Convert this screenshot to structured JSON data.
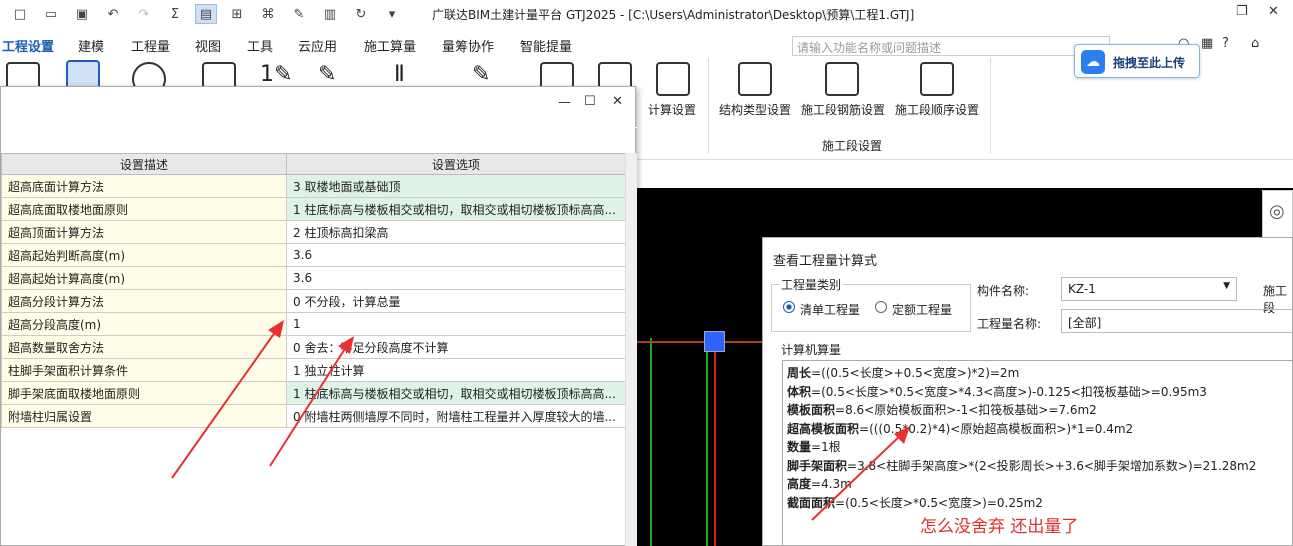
{
  "app": {
    "title": "广联达BIM土建计量平台 GTJ2025 - [C:\\Users\\Administrator\\Desktop\\预算\\工程1.GTJ]"
  },
  "menu": {
    "tabs": [
      "工程设置",
      "建模",
      "工程量",
      "视图",
      "工具",
      "云应用",
      "施工算量",
      "量筹协作",
      "智能提量"
    ],
    "search_placeholder": "请输入功能名称或问题描述"
  },
  "upload": {
    "label": "拖拽至此上传"
  },
  "ribbon": {
    "calc_settings": "计算设置",
    "structure_type": "结构类型设置",
    "section_rebar": "施工段钢筋设置",
    "section_order": "施工段顺序设置",
    "group_section": "施工段设置"
  },
  "settings": {
    "headers": [
      "设置描述",
      "设置选项"
    ],
    "rows": [
      {
        "desc": "超高底面计算方法",
        "value": "3 取楼地面或基础顶"
      },
      {
        "desc": "超高底面取楼地面原则",
        "value": "1 柱底标高与楼板相交或相切，取相交或相切楼板顶标高高..."
      },
      {
        "desc": "超高顶面计算方法",
        "value": "2 柱顶标高扣梁高"
      },
      {
        "desc": "超高起始判断高度(m)",
        "value": "3.6"
      },
      {
        "desc": "超高起始计算高度(m)",
        "value": "3.6"
      },
      {
        "desc": "超高分段计算方法",
        "value": "0 不分段，计算总量"
      },
      {
        "desc": "超高分段高度(m)",
        "value": "1"
      },
      {
        "desc": "超高数量取舍方法",
        "value": "0 舍去：不足分段高度不计算"
      },
      {
        "desc": "柱脚手架面积计算条件",
        "value": "1 独立柱计算"
      },
      {
        "desc": "脚手架底面取楼地面原则",
        "value": "1 柱底标高与楼板相交或相切，取相交或相切楼板顶标高高..."
      },
      {
        "desc": "附墙柱归属设置",
        "value": "0 附墙柱两侧墙厚不同时，附墙柱工程量并入厚度较大的墙..."
      }
    ]
  },
  "quantity_dialog": {
    "title": "查看工程量计算式",
    "type_legend": "工程量类别",
    "radio1": "清单工程量",
    "radio2": "定额工程量",
    "component_label": "构件名称:",
    "component_value": "KZ-1",
    "quantity_label": "工程量名称:",
    "quantity_value": "[全部]",
    "section_cut": "施工段",
    "calc_legend": "计算机算量",
    "formulas": [
      {
        "name": "周长",
        "expr": "=((0.5<长度>+0.5<宽度>)*2)=2m"
      },
      {
        "name": "体积",
        "expr": "=(0.5<长度>*0.5<宽度>*4.3<高度>)-0.125<扣筏板基础>=0.95m3"
      },
      {
        "name": "模板面积",
        "expr": "=8.6<原始模板面积>-1<扣筏板基础>=7.6m2"
      },
      {
        "name": "超高模板面积",
        "expr": "=(((0.5*0.2)*4)<原始超高模板面积>)*1=0.4m2"
      },
      {
        "name": "数量",
        "expr": "=1根"
      },
      {
        "name": "脚手架面积",
        "expr": "=3.8<柱脚手架高度>*(2<投影周长>+3.6<脚手架增加系数>)=21.28m2"
      },
      {
        "name": "高度",
        "expr": "=4.3m"
      },
      {
        "name": "截面面积",
        "expr": "=(0.5<长度>*0.5<宽度>)=0.25m2"
      }
    ]
  },
  "annotation": {
    "text": "怎么没舍弃 还出量了"
  },
  "colors": {
    "accent": "#1a5fb4",
    "highlight": "#def3e6",
    "annotation": "#e03030"
  }
}
